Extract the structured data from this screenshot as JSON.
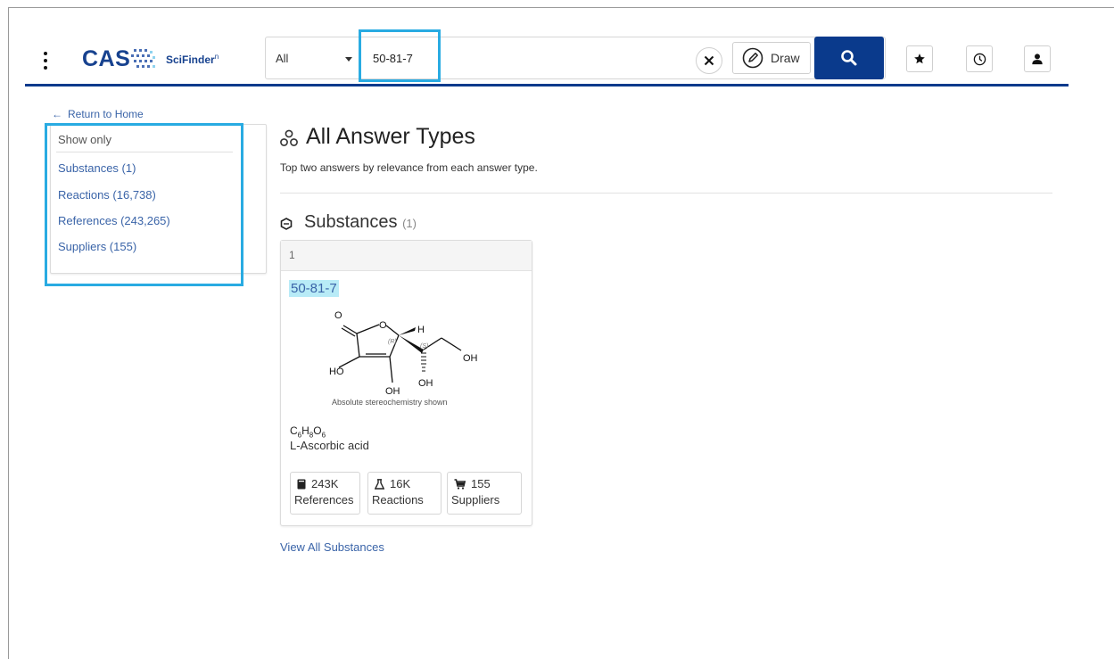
{
  "header": {
    "brand_cas": "CAS",
    "brand_scifinder": "SciFinder",
    "brand_sup": "n",
    "search_type": "All",
    "search_value": "50-81-7",
    "draw_label": "Draw",
    "accent_color": "#0a3a8c"
  },
  "sidebar": {
    "return_label": "Return to Home",
    "show_only_label": "Show only",
    "filters": [
      {
        "label": "Substances (1)"
      },
      {
        "label": "Reactions (16,738)"
      },
      {
        "label": "References (243,265)"
      },
      {
        "label": "Suppliers (155)"
      }
    ]
  },
  "main": {
    "title": "All Answer Types",
    "subtitle": "Top two answers by relevance from each answer type.",
    "substances": {
      "heading": "Substances",
      "count": "(1)",
      "card": {
        "index": "1",
        "cas_rn": "50-81-7",
        "stereo_note": "Absolute stereochemistry shown",
        "formula": {
          "c": "C",
          "c_n": "6",
          "h": "H",
          "h_n": "8",
          "o": "O",
          "o_n": "6"
        },
        "name": "L-Ascorbic acid",
        "stats": [
          {
            "value": "243K",
            "label": "References",
            "icon": "book-icon"
          },
          {
            "value": "16K",
            "label": "Reactions",
            "icon": "flask-icon"
          },
          {
            "value": "155",
            "label": "Suppliers",
            "icon": "cart-icon"
          }
        ],
        "structure_labels": {
          "o1": "O",
          "o2": "O",
          "h": "H",
          "r": "(R)",
          "s": "(S)",
          "oh1": "OH",
          "ho": "HO",
          "oh2": "OH",
          "oh3": "OH"
        }
      },
      "view_all": "View All Substances"
    }
  }
}
